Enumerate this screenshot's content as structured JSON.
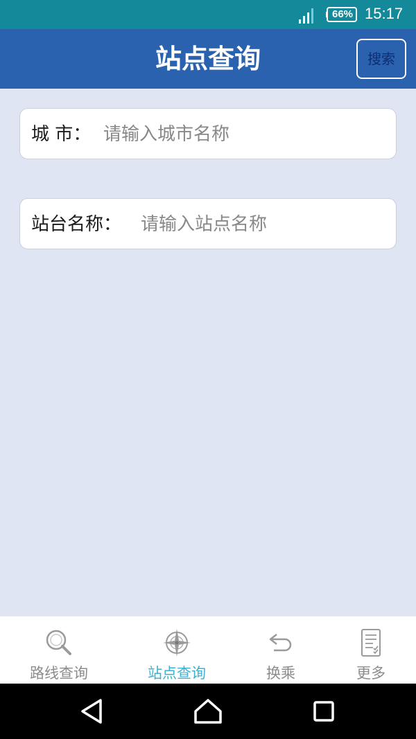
{
  "status_bar": {
    "battery": "66%",
    "time": "15:17"
  },
  "header": {
    "title": "站点查询",
    "search_label": "搜索"
  },
  "form": {
    "city_label": "城 市：",
    "city_placeholder": "请输入城市名称",
    "station_label": "站台名称：",
    "station_placeholder": "请输入站点名称"
  },
  "tabs": [
    {
      "label": "路线查询",
      "icon": "magnifier-icon",
      "active": false
    },
    {
      "label": "站点查询",
      "icon": "compass-icon",
      "active": true
    },
    {
      "label": "换乘",
      "icon": "return-arrow-icon",
      "active": false
    },
    {
      "label": "更多",
      "icon": "checklist-icon",
      "active": false
    }
  ],
  "colors": {
    "status_bar": "#14899a",
    "header": "#2a62b0",
    "background": "#dfe5f2",
    "tab_active": "#3fb1d0",
    "tab_inactive": "#8c8c8c"
  }
}
